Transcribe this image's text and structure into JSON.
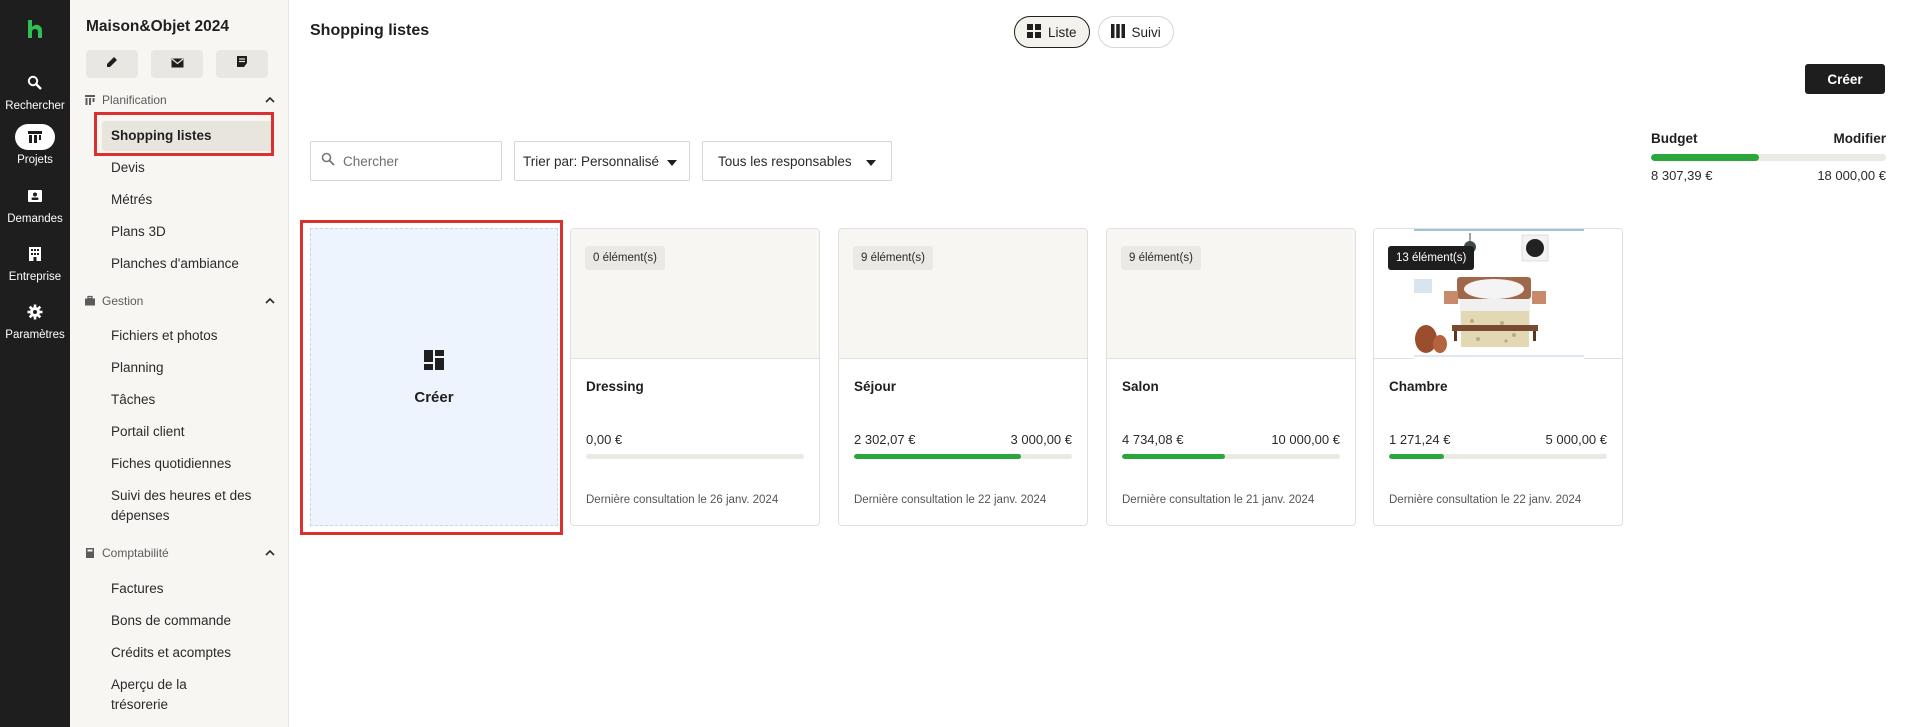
{
  "rail": {
    "items": [
      {
        "label": "Rechercher",
        "icon": "search-icon"
      },
      {
        "label": "Projets",
        "icon": "projects-icon"
      },
      {
        "label": "Demandes",
        "icon": "requests-icon"
      },
      {
        "label": "Entreprise",
        "icon": "building-icon"
      },
      {
        "label": "Paramètres",
        "icon": "gear-icon"
      }
    ],
    "active": "Projets"
  },
  "sidebar": {
    "project_title": "Maison&Objet 2024",
    "sections": [
      {
        "label": "Planification",
        "items": [
          "Shopping listes",
          "Devis",
          "Métrés",
          "Plans 3D",
          "Planches d'ambiance"
        ]
      },
      {
        "label": "Gestion",
        "items": [
          "Fichiers et photos",
          "Planning",
          "Tâches",
          "Portail client",
          "Fiches quotidiennes",
          "Suivi des heures et des dépenses"
        ]
      },
      {
        "label": "Comptabilité",
        "items": [
          "Factures",
          "Bons de commande",
          "Crédits et acomptes",
          "Aperçu de la trésorerie"
        ]
      }
    ],
    "active_item": "Shopping listes"
  },
  "header": {
    "title": "Shopping listes",
    "views": [
      "Liste",
      "Suivi"
    ],
    "active_view": "Liste",
    "create_label": "Créer"
  },
  "filters": {
    "search_placeholder": "Chercher",
    "sort_label": "Trier par: Personnalisé",
    "owner_label": "Tous les responsables"
  },
  "budget": {
    "label": "Budget",
    "edit_label": "Modifier",
    "spent": "8 307,39 €",
    "total": "18 000,00 €",
    "fill_fraction": 0.4615
  },
  "create_card": {
    "label": "Créer"
  },
  "lists": [
    {
      "name": "Dressing",
      "count": "0 élément(s)",
      "amount": "0,00 €",
      "budget": "",
      "fill_fraction": 0,
      "last_viewed": "Dernière consultation le 26 janv. 2024"
    },
    {
      "name": "Séjour",
      "count": "9 élément(s)",
      "amount": "2 302,07 €",
      "budget": "3 000,00 €",
      "fill_fraction": 0.7674,
      "last_viewed": "Dernière consultation le 22 janv. 2024"
    },
    {
      "name": "Salon",
      "count": "9 élément(s)",
      "amount": "4 734,08 €",
      "budget": "10 000,00 €",
      "fill_fraction": 0.4734,
      "last_viewed": "Dernière consultation le 21 janv. 2024"
    },
    {
      "name": "Chambre",
      "count": "13 élément(s)",
      "amount": "1 271,24 €",
      "budget": "5 000,00 €",
      "fill_fraction": 0.2542,
      "last_viewed": "Dernière consultation le 22 janv. 2024"
    }
  ],
  "colors": {
    "accent_green": "#2aa63b",
    "rail_bg": "#1e1e1e",
    "highlight_red": "#d93030",
    "create_card_bg": "#eef4fd"
  }
}
